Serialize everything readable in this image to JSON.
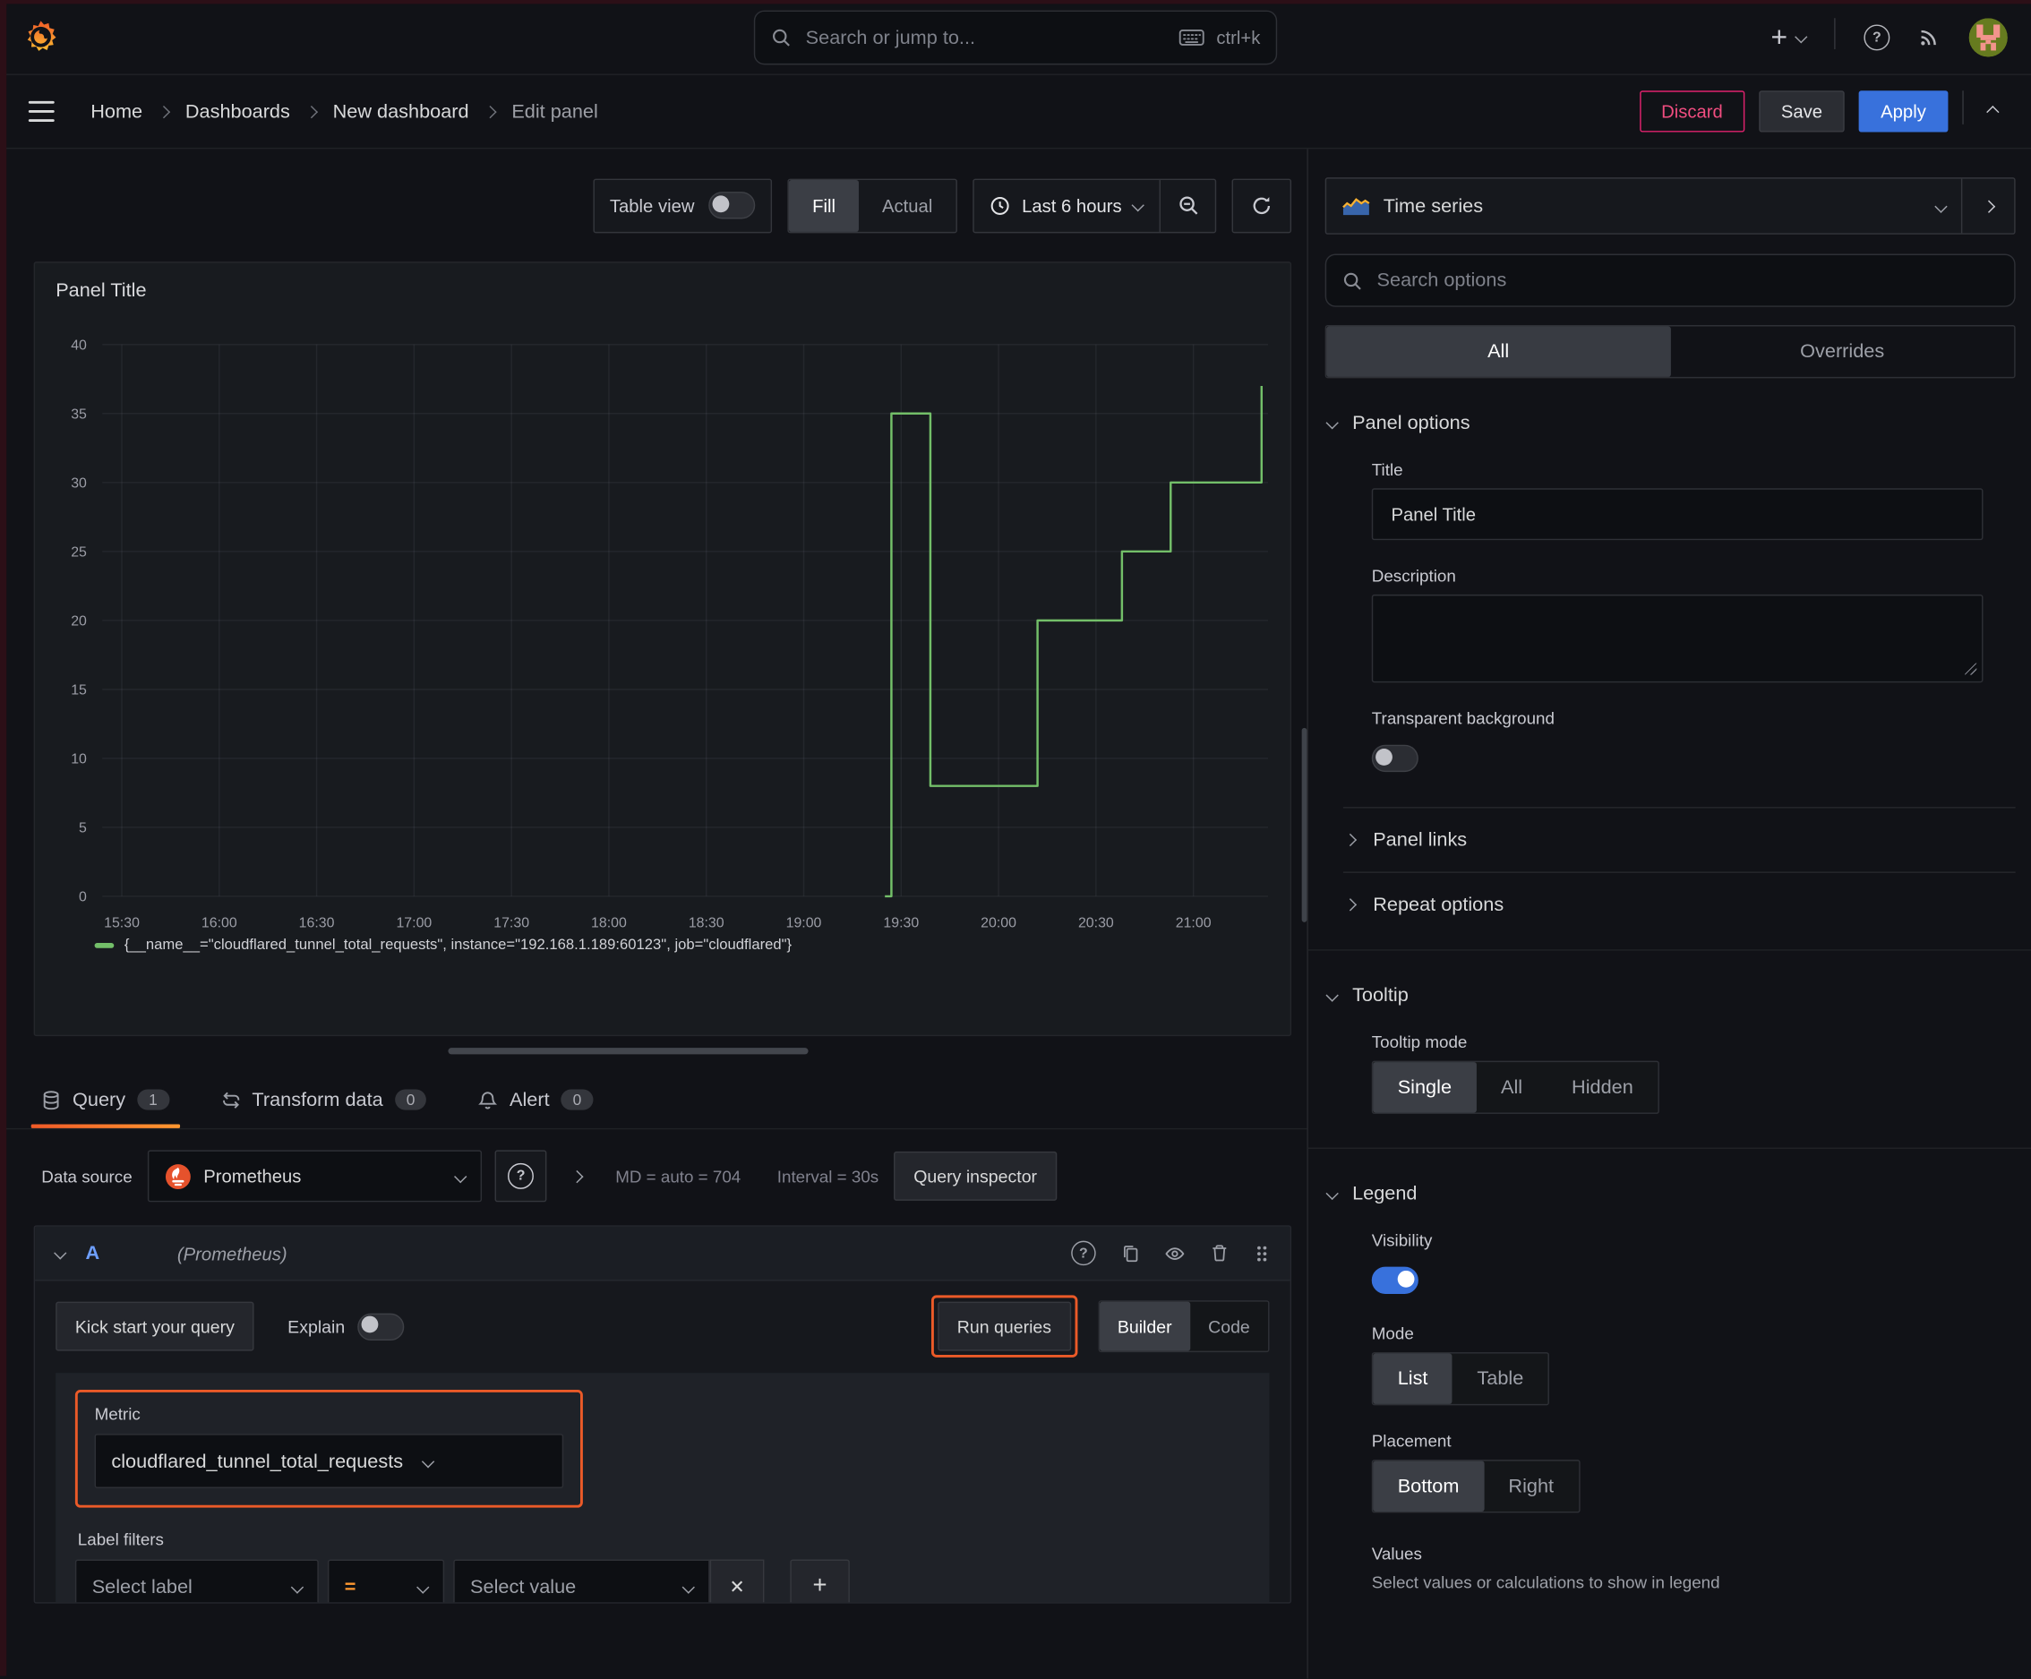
{
  "topbar": {
    "search_placeholder": "Search or jump to...",
    "search_shortcut": "ctrl+k"
  },
  "breadcrumb": {
    "items": [
      "Home",
      "Dashboards",
      "New dashboard",
      "Edit panel"
    ]
  },
  "actions": {
    "discard": "Discard",
    "save": "Save",
    "apply": "Apply"
  },
  "toolbar": {
    "table_view": "Table view",
    "fill": "Fill",
    "actual": "Actual",
    "time_range": "Last 6 hours"
  },
  "viz_picker": {
    "label": "Time series"
  },
  "panel": {
    "title": "Panel Title",
    "legend": "{__name__=\"cloudflared_tunnel_total_requests\", instance=\"192.168.1.189:60123\", job=\"cloudflared\"}"
  },
  "chart_data": {
    "type": "line",
    "line_style": "step",
    "title": "Panel Title",
    "x_ticks": [
      "15:30",
      "16:00",
      "16:30",
      "17:00",
      "17:30",
      "18:00",
      "18:30",
      "19:00",
      "19:30",
      "20:00",
      "20:30",
      "21:00"
    ],
    "y_ticks": [
      0,
      5,
      10,
      15,
      20,
      25,
      30,
      35,
      40
    ],
    "x_range": [
      "15:24",
      "21:23"
    ],
    "ylim": [
      0,
      40
    ],
    "grid": true,
    "legend_position": "bottom",
    "series": [
      {
        "name": "{__name__=\"cloudflared_tunnel_total_requests\", instance=\"192.168.1.189:60123\", job=\"cloudflared\"}",
        "color": "#73bf69",
        "points": [
          [
            "19:25",
            0
          ],
          [
            "19:27",
            0
          ],
          [
            "19:27",
            35
          ],
          [
            "19:39",
            35
          ],
          [
            "19:39",
            8
          ],
          [
            "20:12",
            8
          ],
          [
            "20:12",
            20
          ],
          [
            "20:38",
            20
          ],
          [
            "20:38",
            25
          ],
          [
            "20:53",
            25
          ],
          [
            "20:53",
            30
          ],
          [
            "21:21",
            30
          ],
          [
            "21:21",
            37
          ]
        ]
      }
    ]
  },
  "tabs": {
    "query": "Query",
    "query_count": "1",
    "transform": "Transform data",
    "transform_count": "0",
    "alert": "Alert",
    "alert_count": "0"
  },
  "datasource": {
    "label": "Data source",
    "name": "Prometheus",
    "stats_md": "MD = auto = 704",
    "stats_interval": "Interval = 30s",
    "inspector": "Query inspector"
  },
  "query_row": {
    "ref_id": "A",
    "ds_hint": "(Prometheus)",
    "kick_start": "Kick start your query",
    "explain": "Explain",
    "run_queries": "Run queries",
    "builder": "Builder",
    "code": "Code",
    "metric_label": "Metric",
    "metric_value": "cloudflared_tunnel_total_requests",
    "label_filters_label": "Label filters",
    "select_label": "Select label",
    "operator": "=",
    "select_value": "Select value"
  },
  "options": {
    "search_placeholder": "Search options",
    "tab_all": "All",
    "tab_overrides": "Overrides",
    "panel_options": {
      "title": "Panel options",
      "title_label": "Title",
      "title_value": "Panel Title",
      "description_label": "Description",
      "transparent_label": "Transparent background"
    },
    "panel_links": "Panel links",
    "repeat_options": "Repeat options",
    "tooltip": {
      "title": "Tooltip",
      "mode_label": "Tooltip mode",
      "modes": [
        "Single",
        "All",
        "Hidden"
      ],
      "selected": "Single"
    },
    "legend": {
      "title": "Legend",
      "visibility_label": "Visibility",
      "mode_label": "Mode",
      "modes": [
        "List",
        "Table"
      ],
      "selected_mode": "List",
      "placement_label": "Placement",
      "placements": [
        "Bottom",
        "Right"
      ],
      "selected_placement": "Bottom",
      "values_label": "Values",
      "values_hint": "Select values or calculations to show in legend"
    }
  },
  "icons": {
    "plus": "+",
    "close": "✕",
    "question": "?"
  },
  "colors": {
    "series_green": "#73bf69",
    "highlight_orange": "#eb5a28",
    "accent_blue": "#3871dc",
    "danger_pink": "#e0226e",
    "operator_orange": "#ff9830"
  }
}
